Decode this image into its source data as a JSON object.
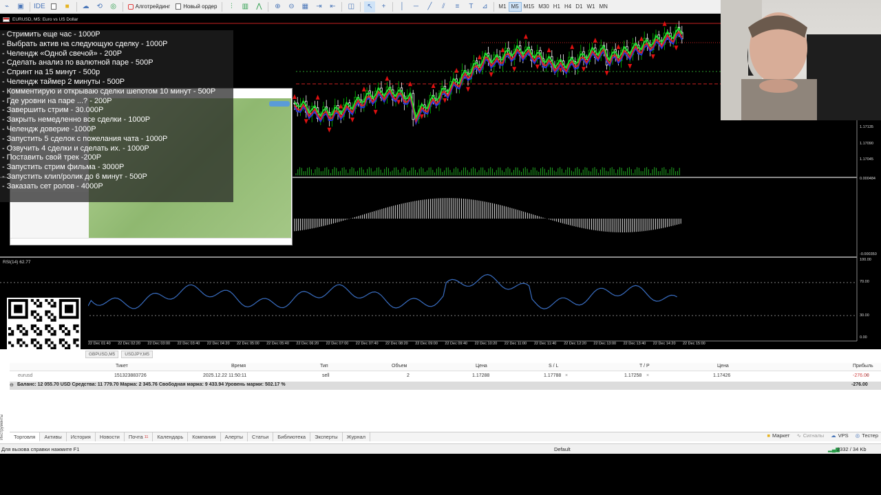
{
  "toolbar": {
    "algo_label": "Алготрейдинг",
    "new_order_label": "Новый ордер",
    "ide_label": "IDE",
    "timeframes": [
      "M1",
      "M5",
      "M15",
      "M30",
      "H1",
      "H4",
      "D1",
      "W1",
      "MN"
    ],
    "active_timeframe": "M5"
  },
  "chart": {
    "symbol_title": "EURUSD, M5:  Euro vs US Dollar",
    "price_labels": [
      "1.17135",
      "1.17090",
      "1.17045"
    ],
    "macd_labels": [
      "0.000484",
      "-0.000350"
    ],
    "rsi_title": "RSI(14) 62.77",
    "rsi_levels": [
      "100.00",
      "70.00",
      "30.00",
      "0.00"
    ],
    "time_labels": [
      "22 Dec 01:40",
      "22 Dec 02:20",
      "22 Dec 03:00",
      "22 Dec 03:40",
      "22 Dec 04:20",
      "22 Dec 05:00",
      "22 Dec 05:40",
      "22 Dec 06:20",
      "22 Dec 07:00",
      "22 Dec 07:40",
      "22 Dec 08:20",
      "22 Dec 09:00",
      "22 Dec 09:40",
      "22 Dec 10:20",
      "22 Dec 11:00",
      "22 Dec 11:40",
      "22 Dec 12:20",
      "22 Dec 13:00",
      "22 Dec 13:40",
      "22 Dec 14:20",
      "22 Dec 15:00"
    ],
    "colors": {
      "bull": "#00c000",
      "bear": "#ffffff",
      "ma_fast": "#22dd33",
      "ma_mid": "#dd2222",
      "ma_slow": "#2233dd",
      "rsi": "#3a6fc4",
      "arrow": "#e01010"
    }
  },
  "donations": [
    "- Стримить еще час - 1000Р",
    "- Выбрать актив на следующую сделку - 1000Р",
    "- Челендж «Одной свечой» - 200Р",
    "- Сделать анализ по валютной паре - 500Р",
    "- Спринт на 15 минут - 500р",
    "- Челендж таймер 2 минуты - 500Р",
    "- Комментирую и открываю сделки шепотом 10 минут - 500Р",
    "- Где уровни на паре ...?  - 200Р",
    "- Завершить стрим - 30.000Р",
    "- Закрыть немедленно все сделки - 1000Р",
    "- Челендж доверие -1000Р",
    "- Запустить 5 сделок с пожелания чата - 1000Р",
    "- Озвучить 4 сделки и сделать их. - 1000Р",
    "- Поставить свой трек -200Р",
    "- Запустить стрим фильма - 3000Р",
    "- Запустить клип/ролик до 6 минут - 500Р",
    "- Заказать сет ролов - 4000Р"
  ],
  "terminal": {
    "symbol_tabs": [
      "GBPUSD,M5",
      "USDJPY,M5"
    ],
    "headers": {
      "symbol": "eurusd",
      "ticket": "Тикет",
      "time": "Время",
      "type": "Тип",
      "volume": "Объем",
      "price": "Цена",
      "sl": "S / L",
      "tp": "T / P",
      "cur_price": "Цена",
      "profit": "Прибыль"
    },
    "row": {
      "ticket": "151323883726",
      "time": "2025.12.22 11:50:11",
      "type": "sell",
      "volume": "2",
      "price": "1.17288",
      "sl": "1.17788",
      "tp": "1.17258",
      "cur_price": "1.17426",
      "profit": "-276.00"
    },
    "balance_text": "Баланс: 12 055.70 USD  Средства: 11 779.70  Маржа: 2 345.76  Свободная маржа: 9 433.94  Уровень маржи: 502.17 %",
    "balance_profit": "-276.00",
    "side_label": "Инструменты"
  },
  "bottom_tabs": [
    {
      "label": "Торговля",
      "badge": ""
    },
    {
      "label": "Активы",
      "badge": ""
    },
    {
      "label": "История",
      "badge": ""
    },
    {
      "label": "Новости",
      "badge": ""
    },
    {
      "label": "Почта",
      "badge": "11"
    },
    {
      "label": "Календарь",
      "badge": ""
    },
    {
      "label": "Компания",
      "badge": ""
    },
    {
      "label": "Алерты",
      "badge": ""
    },
    {
      "label": "Статьи",
      "badge": ""
    },
    {
      "label": "Библиотека",
      "badge": ""
    },
    {
      "label": "Эксперты",
      "badge": ""
    },
    {
      "label": "Журнал",
      "badge": ""
    }
  ],
  "right_tabs": {
    "market": "Маркет",
    "signals": "Сигналы",
    "vps": "VPS",
    "tester": "Тестер"
  },
  "statusbar": {
    "help": "Для вызова справки нажмите F1",
    "profile": "Default",
    "traffic": "2332 / 34 Kb"
  }
}
